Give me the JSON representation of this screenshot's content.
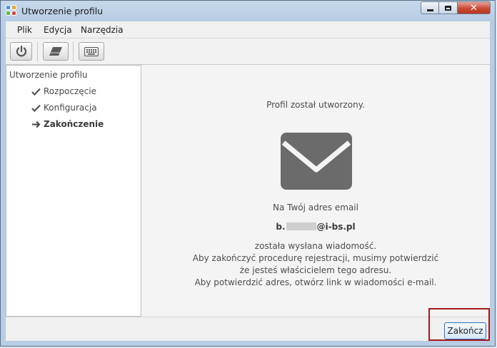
{
  "window": {
    "title": "Utworzenie profilu",
    "close_glyph": "✕"
  },
  "menubar": {
    "items": [
      "Plik",
      "Edycja",
      "Narzędzia"
    ]
  },
  "toolbar": {
    "buttons": [
      {
        "icon": "power-icon"
      },
      {
        "icon": "eraser-icon"
      },
      {
        "icon": "keyboard-icon"
      }
    ]
  },
  "sidebar": {
    "root": "Utworzenie profilu",
    "steps": [
      {
        "label": "Rozpoczęcie",
        "status": "done"
      },
      {
        "label": "Konfiguracja",
        "status": "done"
      },
      {
        "label": "Zakończenie",
        "status": "current"
      }
    ]
  },
  "main": {
    "status": "Profil został utworzony.",
    "icon": "envelope-icon",
    "email_intro": "Na Twój adres email",
    "email_prefix": "b.",
    "email_suffix": "@i-bs.pl",
    "lines": [
      "została wysłana wiadomość.",
      "Aby zakończyć procedurę rejestracji, musimy potwierdzić",
      "że jesteś właścicielem tego adresu.",
      "Aby potwierdzić adres, otwórz link w wiadomości e-mail."
    ]
  },
  "footer": {
    "finish_label": "Zakończ"
  },
  "colors": {
    "highlight": "#a51919",
    "icon_gray": "#6b6b6b"
  }
}
